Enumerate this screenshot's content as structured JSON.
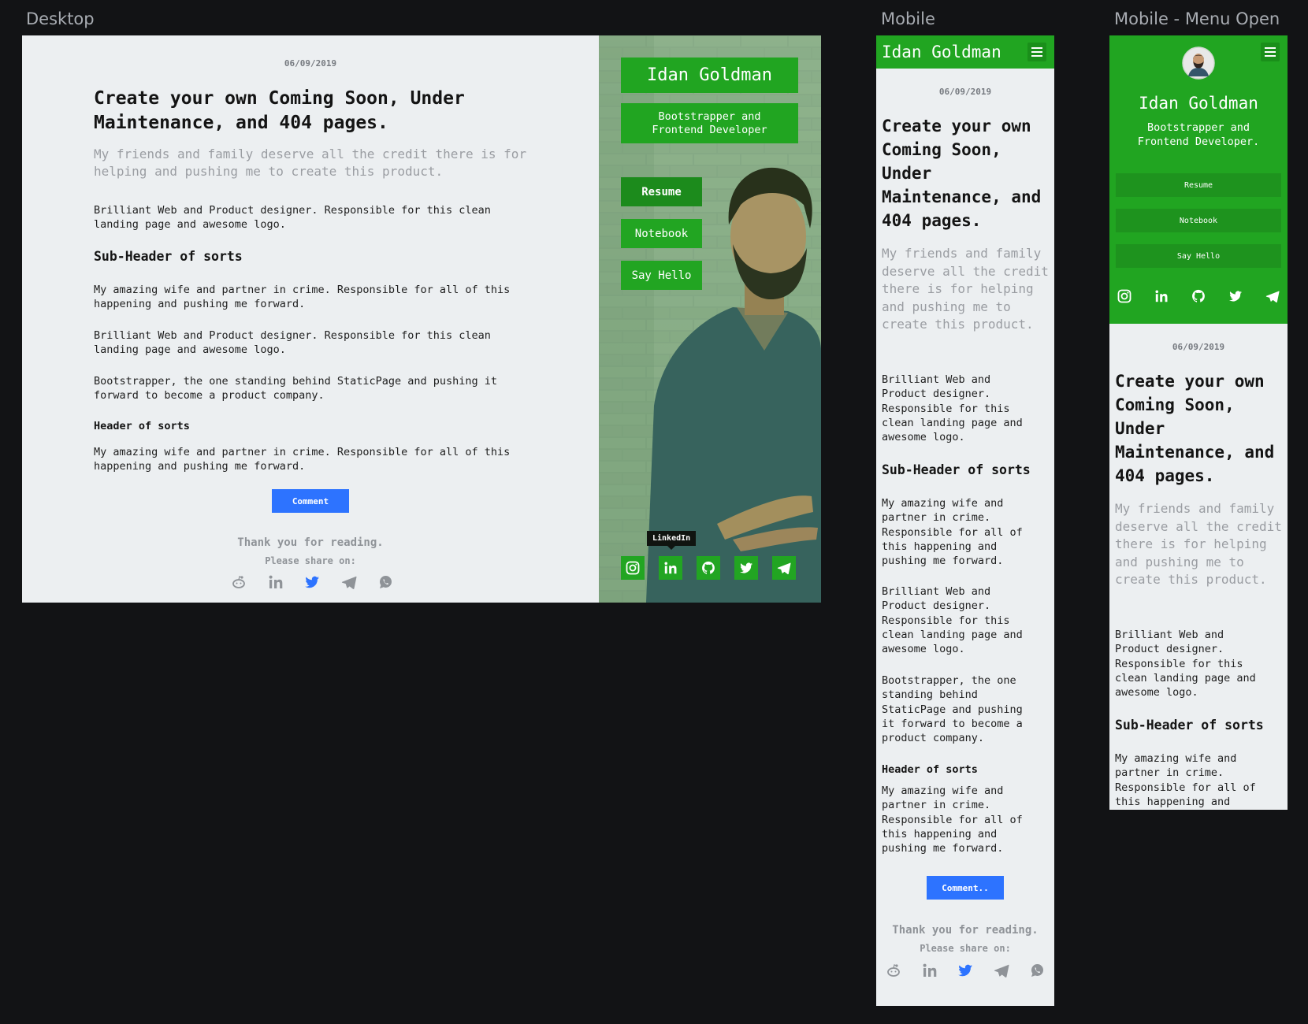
{
  "frame_labels": {
    "desktop": "Desktop",
    "mobile": "Mobile",
    "mobile_open": "Mobile - Menu Open"
  },
  "article": {
    "date": "06/09/2019",
    "title": "Create your own Coming Soon, Under Maintenance, and 404 pages.",
    "lead": "My friends and family deserve all the credit there is for helping and pushing me to create this product.",
    "paragraph_1": "Brilliant Web and Product designer. Responsible for this clean landing page and awesome logo.",
    "subheader": "Sub-Header of sorts",
    "paragraph_2": "My amazing wife and partner in crime. Responsible for all of this happening and pushing me forward.",
    "paragraph_3": "Brilliant Web and Product designer. Responsible for this clean landing page and awesome logo.",
    "paragraph_4": "Bootstrapper, the one standing behind StaticPage and pushing it forward to become a product company.",
    "header_small": "Header of sorts",
    "paragraph_5": "My amazing wife and partner in crime. Responsible for all of this happening and pushing me forward.",
    "comment_button": "Comment",
    "comment_button_mobile": "Comment..",
    "thanks": "Thank you for reading.",
    "share_prompt": "Please share on:",
    "share_icons": [
      "reddit-icon",
      "linkedin-icon",
      "twitter-icon",
      "telegram-icon",
      "whatsapp-icon"
    ]
  },
  "profile": {
    "name": "Idan Goldman",
    "role_desktop": "Bootstrapper and Frontend Developer",
    "role_mobile": "Bootstrapper and Frontend Developer.",
    "nav": [
      "Resume",
      "Notebook",
      "Say Hello"
    ],
    "social": [
      "instagram-icon",
      "linkedin-icon",
      "github-icon",
      "twitter-icon",
      "telegram-icon"
    ],
    "tooltip": "LinkedIn"
  },
  "colors": {
    "page_bg": "#121315",
    "content_bg": "#eceff1",
    "brand_green": "#21a521",
    "accent_blue": "#2d73ff",
    "muted_text": "#9a9da2"
  }
}
